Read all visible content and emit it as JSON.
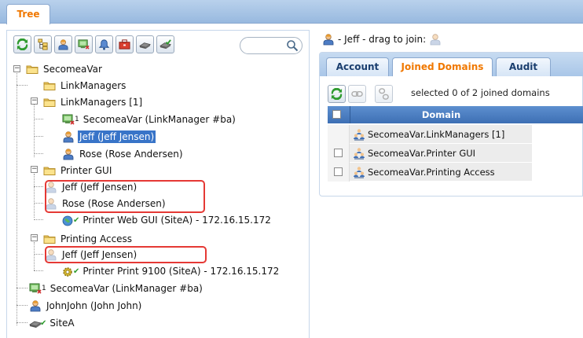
{
  "top_tab": {
    "label": "Tree"
  },
  "search": {
    "value": "",
    "placeholder": ""
  },
  "tree": [
    {
      "label": "SecomeaVar"
    },
    {
      "label": "LinkManagers"
    },
    {
      "label": "LinkManagers [1]"
    },
    {
      "label": "SecomeaVar (LinkManager #ba)",
      "badge": "1"
    },
    {
      "label": "Jeff (Jeff Jensen)",
      "selected": true
    },
    {
      "label": "Rose (Rose Andersen)"
    },
    {
      "label": "Printer GUI"
    },
    {
      "label": "Jeff (Jeff Jensen)"
    },
    {
      "label": "Rose (Rose Andersen)"
    },
    {
      "label": "Printer Web GUI (SiteA) - 172.16.15.172"
    },
    {
      "label": "Printing Access"
    },
    {
      "label": "Jeff (Jeff Jensen)"
    },
    {
      "label": "Printer Print 9100 (SiteA) - 172.16.15.172"
    },
    {
      "label": "SecomeaVar (LinkManager #ba)",
      "badge": "1"
    },
    {
      "label": "JohnJohn (John John)"
    },
    {
      "label": "SiteA"
    }
  ],
  "drag_hint": "- Jeff - drag to join:",
  "tabs": [
    {
      "label": "Account"
    },
    {
      "label": "Joined Domains",
      "active": true
    },
    {
      "label": "Audit"
    }
  ],
  "selection_info": "selected 0 of 2 joined domains",
  "grid": {
    "header": "Domain",
    "rows": [
      {
        "domain": "SecomeaVar.LinkManagers [1]"
      },
      {
        "domain": "SecomeaVar.Printer GUI"
      },
      {
        "domain": "SecomeaVar.Printing Access"
      }
    ]
  },
  "colors": {
    "accent": "#f07800",
    "selection": "#3874c8",
    "highlight": "#e53935",
    "header": "#4a7cc0"
  }
}
